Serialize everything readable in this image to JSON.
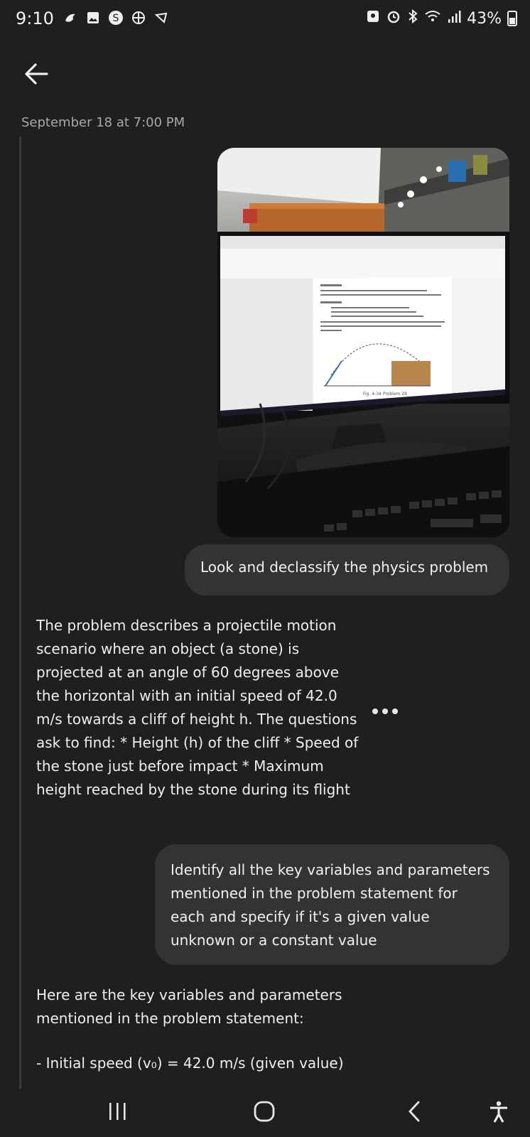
{
  "status_bar": {
    "time": "9:10",
    "battery": "43%",
    "left_icons": [
      "bird-icon",
      "gallery-icon",
      "s-app-icon",
      "pinwheel-icon",
      "shield-icon"
    ],
    "right_icons": [
      "contact-icon",
      "alarm-icon",
      "bluetooth-icon",
      "wifi-icon",
      "signal-icon",
      "battery-icon"
    ]
  },
  "header": {
    "back_icon": "arrow-left-icon"
  },
  "thread": {
    "date": "September 18 at 7:00 PM",
    "user_message_1": "Look and declassify the physics problem",
    "assistant_message_1": "The problem describes a projectile motion scenario where an object (a stone) is projected at an angle of 60 degrees above the horizontal with an initial speed of 42.0 m/s towards a cliff of height h. The questions ask to find: * Height (h) of the cliff * Speed of the stone just before impact * Maximum height reached by the stone during its flight",
    "user_message_2": "Identify all the key variables and parameters mentioned in the problem statement for each and specify if it's a given value unknown or a constant value",
    "assistant_message_2_intro": "Here are the key variables and parameters mentioned in the problem statement:",
    "assistant_message_2_item": "- Initial speed (v₀) = 42.0 m/s (given value)"
  },
  "photo": {
    "description_icon": "monitor-photo",
    "doc_caption": "Fig. 4-34 Problem 28"
  },
  "nav_bar": {
    "recent_icon": "recents-icon",
    "home_icon": "home-icon",
    "back_icon": "nav-back-icon",
    "accessibility_icon": "accessibility-icon"
  }
}
